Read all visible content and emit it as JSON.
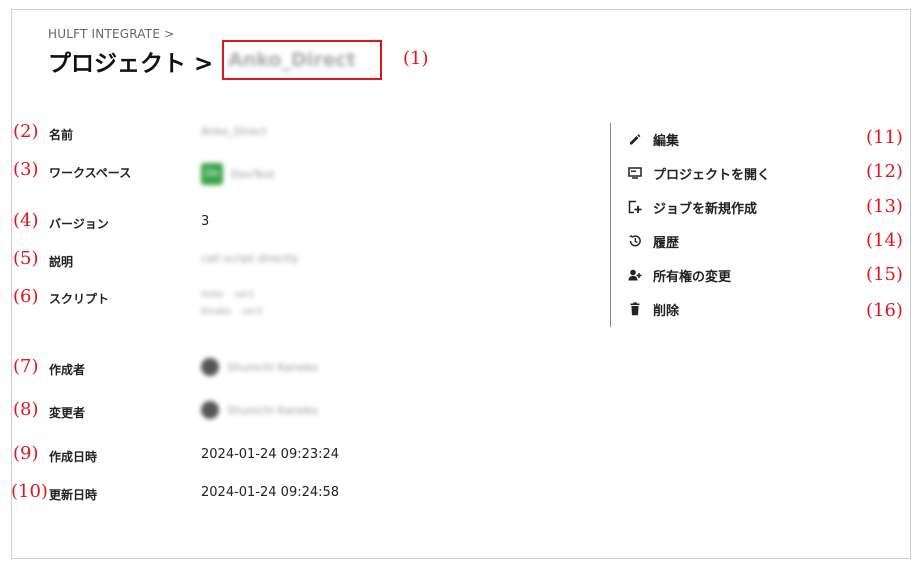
{
  "breadcrumb": "HULFT INTEGRATE >",
  "title": {
    "prefix": "プロジェクト >",
    "name": "Anko_Direct"
  },
  "annotations": [
    "(1)",
    "(2)",
    "(3)",
    "(4)",
    "(5)",
    "(6)",
    "(7)",
    "(8)",
    "(9)",
    "(10)",
    "(11)",
    "(12)",
    "(13)",
    "(14)",
    "(15)",
    "(16)"
  ],
  "details": {
    "name": {
      "label": "名前",
      "value": "Anko_Direct"
    },
    "workspace": {
      "label": "ワークスペース",
      "badge": "De",
      "value": "DevTest"
    },
    "version": {
      "label": "バージョン",
      "value": "3"
    },
    "description": {
      "label": "説明",
      "value": "call script directly"
    },
    "scripts": {
      "label": "スクリプト",
      "items": [
        {
          "name": "Anko",
          "ver": "ver1"
        },
        {
          "name": "Kinako",
          "ver": "ver3"
        }
      ]
    },
    "created_by": {
      "label": "作成者",
      "value": "Shunichi Kaneko"
    },
    "updated_by": {
      "label": "変更者",
      "value": "Shunichi Kaneko"
    },
    "created_at": {
      "label": "作成日時",
      "value": "2024-01-24 09:23:24"
    },
    "updated_at": {
      "label": "更新日時",
      "value": "2024-01-24 09:24:58"
    }
  },
  "actions": [
    {
      "label": "編集",
      "icon": "pencil-icon"
    },
    {
      "label": "プロジェクトを開く",
      "icon": "open-project-icon"
    },
    {
      "label": "ジョブを新規作成",
      "icon": "new-job-icon"
    },
    {
      "label": "履歴",
      "icon": "history-icon"
    },
    {
      "label": "所有権の変更",
      "icon": "change-owner-icon"
    },
    {
      "label": "削除",
      "icon": "trash-icon"
    }
  ],
  "colors": {
    "annotation": "#e3141b",
    "workspace_badge": "#3aa34a"
  }
}
